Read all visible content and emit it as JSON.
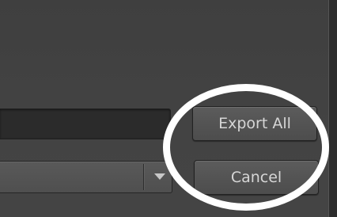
{
  "window": {
    "background": "#414141"
  },
  "form": {
    "name_value": "",
    "preset_value": ""
  },
  "buttons": {
    "export_all_label": "Export All",
    "cancel_label": "Cancel"
  },
  "annotation": {
    "highlight_color": "#ffffff",
    "shape": "ellipse"
  },
  "icons": {
    "dropdown": "triangle-down-icon"
  }
}
